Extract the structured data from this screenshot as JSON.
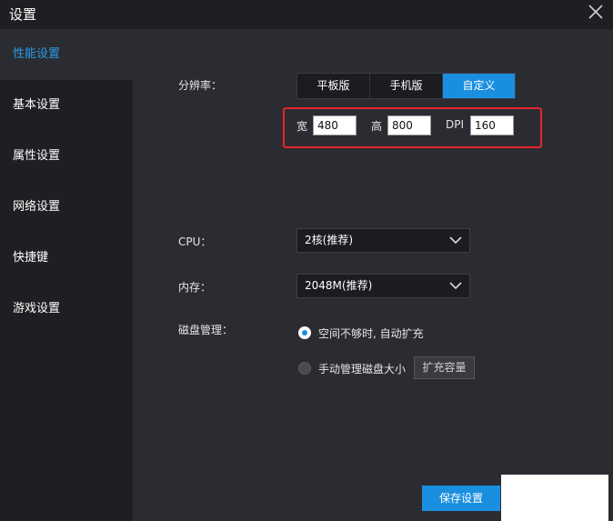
{
  "window": {
    "title": "设置"
  },
  "sidebar": {
    "items": [
      {
        "label": "性能设置",
        "active": true
      },
      {
        "label": "基本设置"
      },
      {
        "label": "属性设置"
      },
      {
        "label": "网络设置"
      },
      {
        "label": "快捷键"
      },
      {
        "label": "游戏设置"
      }
    ]
  },
  "resolution": {
    "label": "分辨率：",
    "options": [
      "平板版",
      "手机版",
      "自定义"
    ],
    "selected": "自定义",
    "width_label": "宽",
    "width_value": "480",
    "height_label": "高",
    "height_value": "800",
    "dpi_label": "DPI",
    "dpi_value": "160"
  },
  "cpu": {
    "label": "CPU：",
    "value": "2核(推荐)"
  },
  "memory": {
    "label": "内存：",
    "value": "2048M(推荐)"
  },
  "disk": {
    "label": "磁盘管理：",
    "option_auto": "空间不够时, 自动扩充",
    "option_manual": "手动管理磁盘大小",
    "expand_button": "扩充容量",
    "selected": "auto"
  },
  "footer": {
    "save_label": "保存设置"
  },
  "colors": {
    "accent": "#1a8fe0",
    "highlight_border": "#e8232b",
    "active_nav_text": "#2b9be8"
  },
  "icons": {
    "close": "close-icon",
    "dropdown": "chevron-down-icon"
  }
}
